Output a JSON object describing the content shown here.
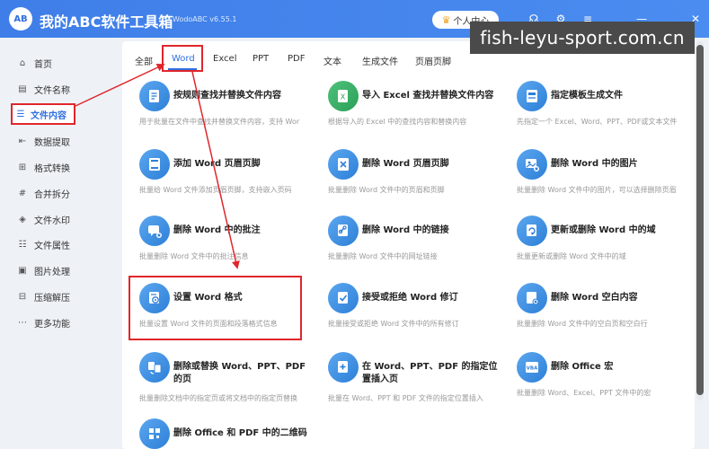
{
  "window": {
    "title": "我的ABC软件工具箱",
    "version": "WodoABC v6.55.1",
    "logo_text": "AB",
    "vip_label": "个人中心"
  },
  "watermark": "fish-leyu-sport.com.cn",
  "sidebar": {
    "items": [
      {
        "label": "首页",
        "icon": "home-icon"
      },
      {
        "label": "文件名称",
        "icon": "file-icon"
      },
      {
        "label": "文件内容",
        "icon": "list-icon",
        "active": true
      },
      {
        "label": "数据提取",
        "icon": "extract-icon"
      },
      {
        "label": "格式转换",
        "icon": "convert-icon"
      },
      {
        "label": "合并拆分",
        "icon": "merge-icon"
      },
      {
        "label": "文件水印",
        "icon": "watermark-icon"
      },
      {
        "label": "文件属性",
        "icon": "properties-icon"
      },
      {
        "label": "图片处理",
        "icon": "image-icon"
      },
      {
        "label": "压缩解压",
        "icon": "compress-icon"
      },
      {
        "label": "更多功能",
        "icon": "more-icon"
      }
    ]
  },
  "tabs": [
    {
      "label": "全部"
    },
    {
      "label": "Word",
      "active": true
    },
    {
      "label": "Excel"
    },
    {
      "label": "PPT"
    },
    {
      "label": "PDF"
    },
    {
      "label": "文本"
    },
    {
      "label": "生成文件"
    },
    {
      "label": "页眉页脚"
    }
  ],
  "cards": [
    {
      "title": "按规则查找并替换文件内容",
      "desc": "用于批量在文件中查找并替换文件内容，支持 Wor"
    },
    {
      "title": "导入 Excel 查找并替换文件内容",
      "desc": "根据导入的 Excel 中的查找内容和替换内容"
    },
    {
      "title": "指定模板生成文件",
      "desc": "先指定一个 Excel、Word、PPT、PDF或文本文件"
    },
    {
      "title": "添加 Word 页眉页脚",
      "desc": "批量给 Word 文件添加页眉页脚，支持嵌入页码"
    },
    {
      "title": "删除 Word 页眉页脚",
      "desc": "批量删除 Word 文件中的页眉和页脚"
    },
    {
      "title": "删除 Word 中的图片",
      "desc": "批量删除 Word 文件中的图片，可以选择删除页眉"
    },
    {
      "title": "删除 Word 中的批注",
      "desc": "批量删除 Word 文件中的批注信息"
    },
    {
      "title": "删除 Word 中的链接",
      "desc": "批量删除 Word 文件中的网址链接"
    },
    {
      "title": "更新或删除 Word 中的域",
      "desc": "批量更新或删除 Word 文件中的域"
    },
    {
      "title": "设置 Word 格式",
      "desc": "批量设置 Word 文件的页面和段落格式信息"
    },
    {
      "title": "接受或拒绝 Word 修订",
      "desc": "批量接受或拒绝 Word 文件中的所有修订"
    },
    {
      "title": "删除 Word 空白内容",
      "desc": "批量删除 Word 文件中的空白页和空白行"
    },
    {
      "title": "删除或替换 Word、PPT、PDF 的页",
      "desc": "批量删除文档中的指定页或将文档中的指定页替换"
    },
    {
      "title": "在 Word、PPT、PDF 的指定位置插入页",
      "desc": "批量在 Word、PPT 和 PDF 文件的指定位置插入"
    },
    {
      "title": "删除 Office 宏",
      "desc": "批量删除 Word、Excel、PPT 文件中的宏"
    },
    {
      "title": "删除 Office 和 PDF 中的二维码",
      "desc": ""
    }
  ]
}
